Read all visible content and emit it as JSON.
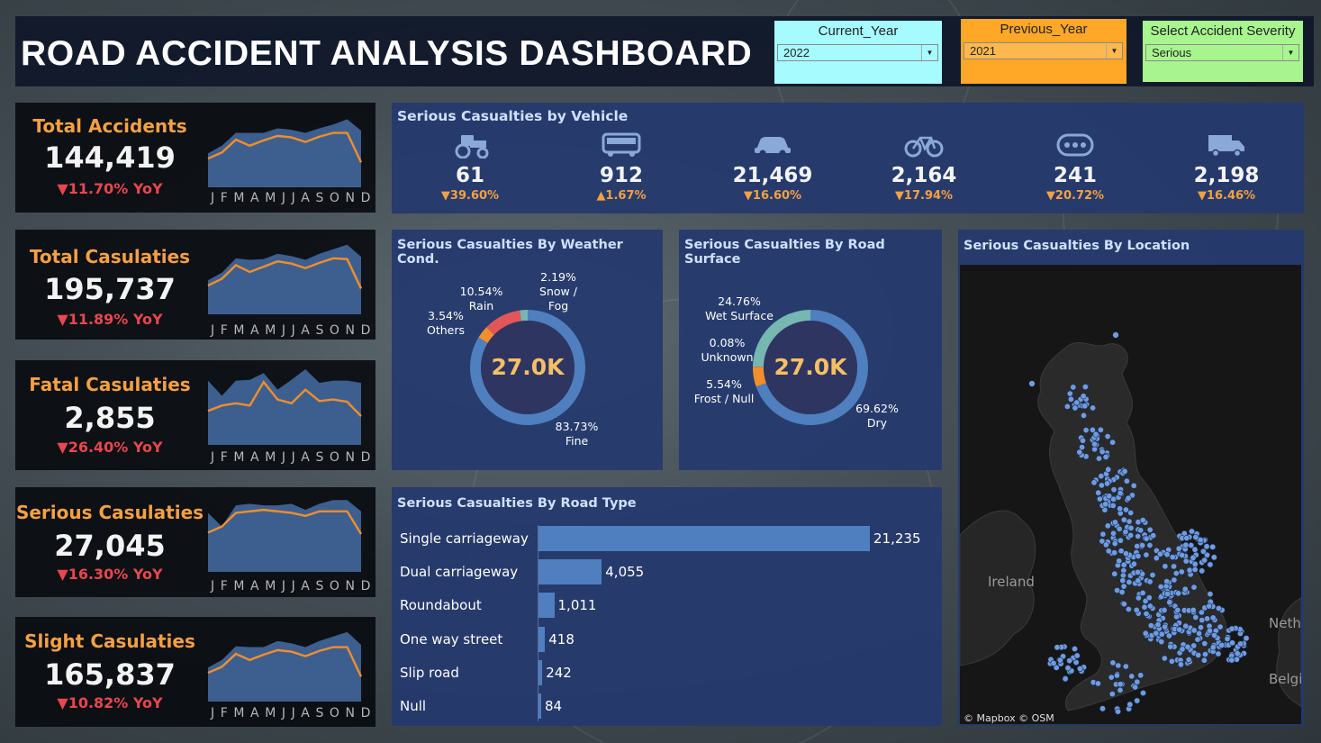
{
  "header": {
    "title": "ROAD ACCIDENT ANALYSIS DASHBOARD",
    "filters": [
      {
        "label": "Current_Year",
        "value": "2022",
        "color": "#a6fbff"
      },
      {
        "label": "Previous_Year",
        "value": "2021",
        "color": "#ffa726"
      },
      {
        "label": "Select Accident Severity",
        "value": "Serious",
        "color": "#a8f590"
      }
    ]
  },
  "months": [
    "J",
    "F",
    "M",
    "A",
    "M",
    "J",
    "J",
    "A",
    "S",
    "O",
    "N",
    "D"
  ],
  "kpis": [
    {
      "label": "Total Accidents",
      "value": "144,419",
      "yoy": "▼11.70% YoY",
      "area": [
        0.45,
        0.55,
        0.72,
        0.72,
        0.72,
        0.78,
        0.76,
        0.72,
        0.78,
        0.83,
        0.9,
        0.75
      ],
      "line": [
        0.38,
        0.46,
        0.63,
        0.55,
        0.62,
        0.68,
        0.66,
        0.6,
        0.67,
        0.72,
        0.72,
        0.33
      ]
    },
    {
      "label": "Total Casulaties",
      "value": "195,737",
      "yoy": "▼11.89%  YoY",
      "area": [
        0.45,
        0.55,
        0.74,
        0.72,
        0.73,
        0.8,
        0.77,
        0.72,
        0.8,
        0.86,
        0.92,
        0.76
      ],
      "line": [
        0.38,
        0.47,
        0.65,
        0.56,
        0.63,
        0.7,
        0.67,
        0.61,
        0.68,
        0.74,
        0.73,
        0.34
      ]
    },
    {
      "label": "Fatal Casulaties",
      "value": "2,855",
      "yoy": "▼26.40%  YoY",
      "area": [
        0.85,
        0.65,
        0.85,
        0.86,
        0.95,
        0.73,
        0.86,
        1.0,
        0.82,
        0.85,
        0.85,
        0.82
      ],
      "line": [
        0.45,
        0.52,
        0.55,
        0.52,
        0.83,
        0.6,
        0.55,
        0.73,
        0.58,
        0.6,
        0.57,
        0.38
      ]
    },
    {
      "label": "Serious Casulaties",
      "value": "27,045",
      "yoy": "▼16.30%  YoY",
      "area": [
        0.78,
        0.6,
        0.88,
        0.9,
        0.88,
        0.88,
        0.9,
        0.82,
        0.9,
        0.95,
        0.95,
        0.8
      ],
      "line": [
        0.52,
        0.6,
        0.78,
        0.8,
        0.82,
        0.8,
        0.78,
        0.74,
        0.8,
        0.8,
        0.8,
        0.5
      ]
    },
    {
      "label": "Slight Casulaties",
      "value": "165,837",
      "yoy": "▼10.82%  YoY",
      "area": [
        0.45,
        0.55,
        0.73,
        0.72,
        0.72,
        0.8,
        0.77,
        0.72,
        0.8,
        0.86,
        0.92,
        0.75
      ],
      "line": [
        0.38,
        0.46,
        0.63,
        0.55,
        0.62,
        0.68,
        0.66,
        0.6,
        0.67,
        0.72,
        0.72,
        0.33
      ]
    }
  ],
  "vehicles": {
    "title": "Serious Casualties by Vehicle",
    "items": [
      {
        "icon": "tractor-icon",
        "value": "61",
        "change": "▼39.60%"
      },
      {
        "icon": "bus-icon",
        "value": "912",
        "change": "▲1.67%"
      },
      {
        "icon": "car-icon",
        "value": "21,469",
        "change": "▼16.60%"
      },
      {
        "icon": "bicycle-icon",
        "value": "2,164",
        "change": "▼17.94%"
      },
      {
        "icon": "other-vehicle-icon",
        "value": "241",
        "change": "▼20.72%"
      },
      {
        "icon": "van-icon",
        "value": "2,198",
        "change": "▼16.46%"
      }
    ]
  },
  "weather": {
    "title": "Serious Casualties By Weather Cond.",
    "center": "27.0K",
    "slices": [
      {
        "name": "Fine",
        "pct": "83.73%",
        "value": 83.73,
        "color": "#4f7fbf"
      },
      {
        "name": "Others",
        "pct": "3.54%",
        "value": 3.54,
        "color": "#f28e2b"
      },
      {
        "name": "Rain",
        "pct": "10.54%",
        "value": 10.54,
        "color": "#e15759"
      },
      {
        "name": "Snow / Fog",
        "pct": "2.19%",
        "value": 2.19,
        "color": "#76b7b2"
      }
    ]
  },
  "surface": {
    "title": "Serious Casualties By Road Surface",
    "center": "27.0K",
    "slices": [
      {
        "name": "Dry",
        "pct": "69.62%",
        "value": 69.62,
        "color": "#4f7fbf"
      },
      {
        "name": "Frost / Null",
        "pct": "5.54%",
        "value": 5.54,
        "color": "#f28e2b"
      },
      {
        "name": "Unknown",
        "pct": "0.08%",
        "value": 0.08,
        "color": "#e15759"
      },
      {
        "name": "Wet Surface",
        "pct": "24.76%",
        "value": 24.76,
        "color": "#76b7b2"
      }
    ]
  },
  "roadtype": {
    "title": "Serious Casualties By Road Type",
    "rows": [
      {
        "name": "Single carriageway",
        "value": 21235,
        "label": "21,235"
      },
      {
        "name": "Dual carriageway",
        "value": 4055,
        "label": "4,055"
      },
      {
        "name": "Roundabout",
        "value": 1011,
        "label": "1,011"
      },
      {
        "name": "One way street",
        "value": 418,
        "label": "418"
      },
      {
        "name": "Slip road",
        "value": 242,
        "label": "242"
      },
      {
        "name": "Null",
        "value": 84,
        "label": "84"
      }
    ]
  },
  "location": {
    "title": "Serious Casualties By Location",
    "labels": [
      "Ireland",
      "Neth",
      "Belgi"
    ],
    "credit": "© Mapbox © OSM"
  }
}
